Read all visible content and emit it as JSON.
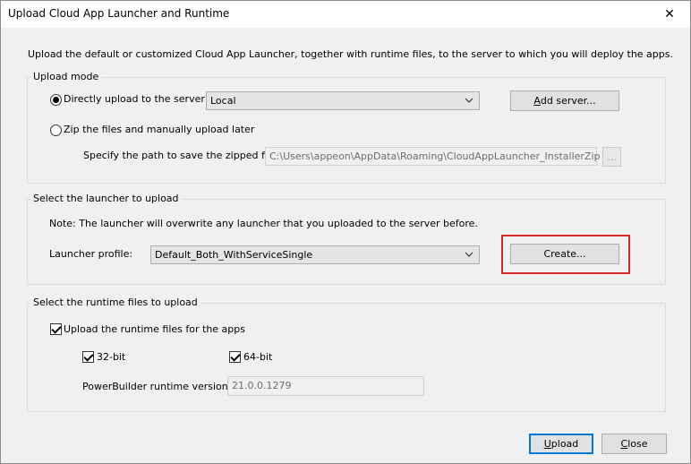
{
  "window": {
    "title": "Upload Cloud App Launcher and Runtime",
    "close_glyph": "✕"
  },
  "intro": "Upload the default or customized Cloud App Launcher, together with runtime files, to the server to which you will deploy the apps.",
  "upload_mode": {
    "group_title": "Upload mode",
    "direct_label": "Directly upload to the server",
    "direct_selected": true,
    "server_value": "Local",
    "add_server_prefix": "A",
    "add_server_rest": "dd server...",
    "zip_label": "Zip the files and manually upload later",
    "zip_selected": false,
    "path_label": "Specify the path to save the zipped file:",
    "path_value": "C:\\Users\\appeon\\AppData\\Roaming\\CloudAppLauncher_InstallerZip",
    "browse_label": "..."
  },
  "launcher": {
    "group_title": "Select the launcher to upload",
    "note": "Note: The launcher will overwrite any launcher that you uploaded to the server before.",
    "profile_label": "Launcher profile:",
    "profile_value": "Default_Both_WithServiceSingle",
    "create_label": "Create..."
  },
  "runtime": {
    "group_title": "Select the runtime files to upload",
    "upload_label": "Upload the runtime files for the apps",
    "upload_checked": true,
    "bit32_label": "32-bit",
    "bit32_checked": true,
    "bit64_label": "64-bit",
    "bit64_checked": true,
    "version_label": "PowerBuilder runtime version:",
    "version_value": "21.0.0.1279"
  },
  "footer": {
    "upload_prefix": "U",
    "upload_rest": "pload",
    "close_prefix": "C",
    "close_rest": "lose"
  },
  "colors": {
    "accent": "#0078d7",
    "highlight": "#d9282e"
  }
}
